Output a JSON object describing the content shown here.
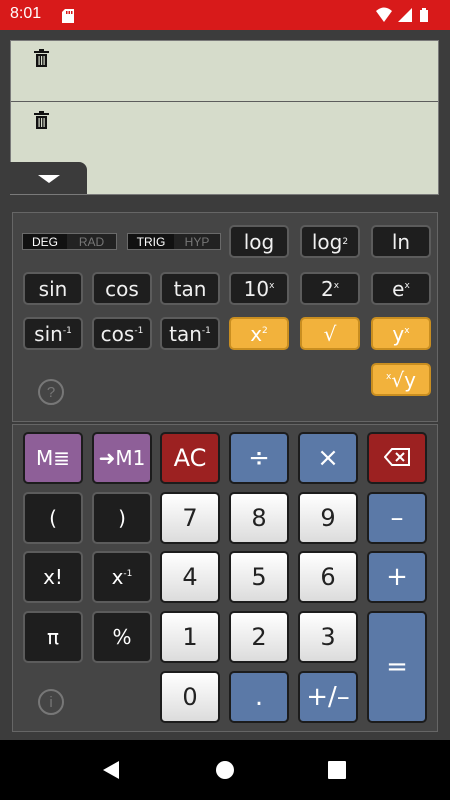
{
  "status_bar": {
    "time": "8:01",
    "icons": [
      "sd-card-icon",
      "wifi-icon",
      "signal-icon",
      "battery-icon"
    ]
  },
  "display": {
    "history_icons": [
      "trash-icon",
      "trash-icon"
    ],
    "toggle_icon": "chevron-down-icon"
  },
  "modes": {
    "angle": {
      "on": "DEG",
      "off": "RAD"
    },
    "func": {
      "on": "TRIG",
      "off": "HYP"
    }
  },
  "sci_keys": {
    "log": "log",
    "log2": "log",
    "log2_sub": "2",
    "ln": "ln",
    "sin": "sin",
    "cos": "cos",
    "tan": "tan",
    "pow10": "10",
    "pow10_sup": "x",
    "pow2": "2",
    "pow2_sup": "x",
    "exp": "e",
    "exp_sup": "x",
    "asin": "sin",
    "asin_sup": "-1",
    "acos": "cos",
    "acos_sup": "-1",
    "atan": "tan",
    "atan_sup": "-1",
    "square": "x",
    "square_sup": "2",
    "sqrt": "√",
    "power": "y",
    "power_sup": "x",
    "root": "√y",
    "root_sup": "x",
    "help": "?"
  },
  "num_keys": {
    "memory_list": "M≣",
    "memory_store": "M1",
    "clear": "AC",
    "divide": "÷",
    "multiply": "×",
    "open_paren": "(",
    "close_paren": ")",
    "factorial": "x!",
    "reciprocal": "x",
    "reciprocal_sup": "-1",
    "pi": "π",
    "percent": "%",
    "seven": "7",
    "eight": "8",
    "nine": "9",
    "minus": "–",
    "four": "4",
    "five": "5",
    "six": "6",
    "plus": "+",
    "one": "1",
    "two": "2",
    "three": "3",
    "equals": "=",
    "zero": "0",
    "decimal": ".",
    "sign": "+/–",
    "info": "i"
  },
  "colors": {
    "status_bar": "#d81a1a",
    "display_bg": "#d6dccb",
    "accent_orange": "#f2b23c",
    "accent_blue": "#5b79a7",
    "accent_red": "#9c2121",
    "accent_purple": "#8e5f98"
  }
}
